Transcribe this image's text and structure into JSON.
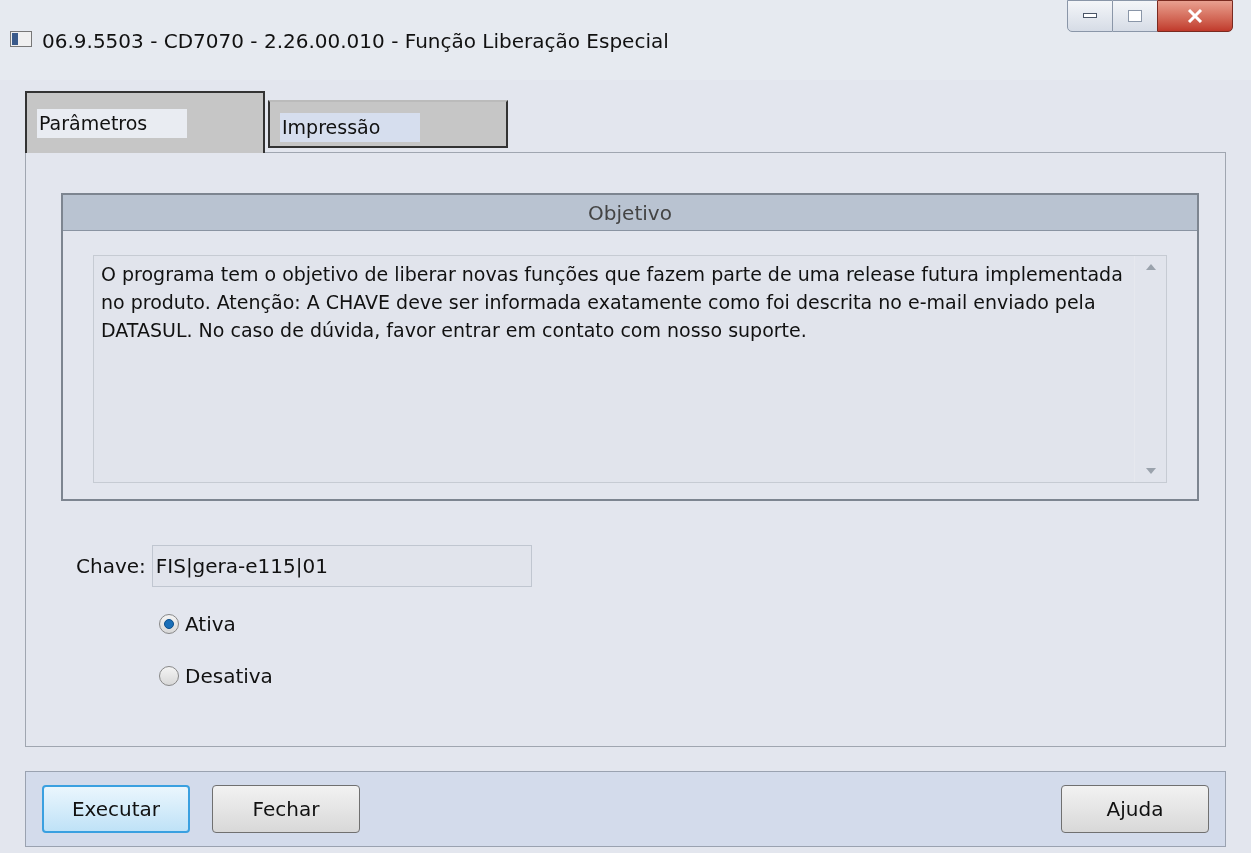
{
  "window": {
    "title": "06.9.5503 - CD7070 - 2.26.00.010 - Função Liberação Especial"
  },
  "tabs": [
    {
      "label": "Parâmetros",
      "selected": true
    },
    {
      "label": "Impressão",
      "selected": false
    }
  ],
  "objective": {
    "title": "Objetivo",
    "text": "O programa tem o objetivo de liberar novas funções que fazem parte de uma release futura implementada no produto. Atenção: A CHAVE deve ser informada exatamente como foi descrita no e-mail enviado pela DATASUL. No caso de dúvida, favor entrar em contato com nosso suporte."
  },
  "key_field": {
    "label": "Chave:",
    "value": "FIS|gera-e115|01"
  },
  "options": [
    {
      "label": "Ativa",
      "selected": true
    },
    {
      "label": "Desativa",
      "selected": false
    }
  ],
  "buttons": [
    {
      "label": "Executar",
      "kind": "default"
    },
    {
      "label": "Fechar",
      "kind": "normal"
    },
    {
      "label": "Ajuda",
      "kind": "normal"
    }
  ]
}
